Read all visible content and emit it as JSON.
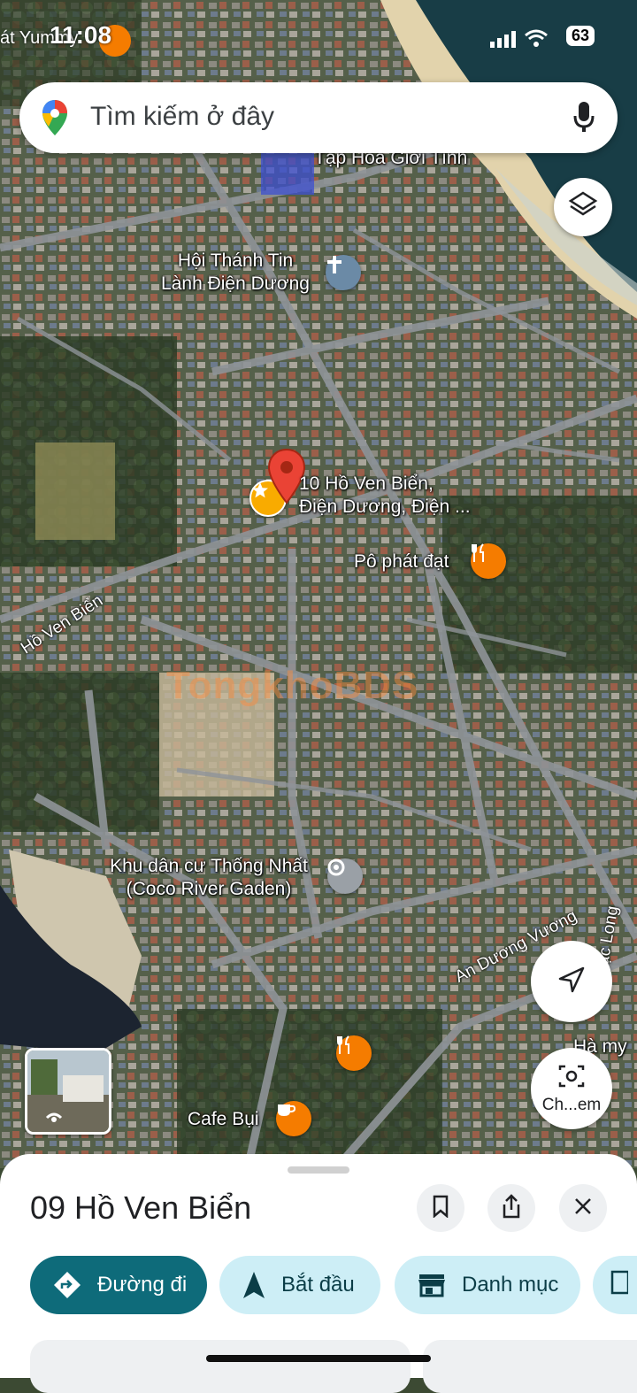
{
  "status": {
    "carrier": "át Yummy",
    "time": "11:08",
    "battery": "63"
  },
  "search": {
    "placeholder": "Tìm kiếm ở đây"
  },
  "map": {
    "labels": {
      "top_partial": "Tạp Hóa Giới Tính",
      "church_line1": "Hội Thánh Tin",
      "church_line2": "Lành Điện Dương",
      "pin_line1": "10 Hồ Ven Biển,",
      "pin_line2": "Điện Dương, Điện ...",
      "restaurant": "Pô phát đạt",
      "road_ho_ven_bien": "Hồ Ven Biển",
      "residential_line1": "Khu dân cư Thống Nhất",
      "residential_line2": "(Coco River Gaden)",
      "road_an_duong_vuong": "An Dương Vương",
      "road_lac_long": "Lạc Long",
      "ha_my": "Hà my",
      "cafe": "Cafe Bụi",
      "lens_label": "Ch...em"
    },
    "watermark": "TongkhoBDS"
  },
  "sheet": {
    "title": "09 Hồ Ven Biển",
    "chips": {
      "directions": "Đường đi",
      "start": "Bắt đầu",
      "category": "Danh mục"
    }
  },
  "icons": [
    "maps-logo-icon",
    "mic-icon",
    "layers-icon",
    "church-icon",
    "star-icon",
    "map-pin-icon",
    "restaurant-icon",
    "place-icon",
    "navigation-arrow-icon",
    "lens-icon",
    "cafe-icon",
    "bookmark-icon",
    "share-icon",
    "close-icon",
    "directions-icon",
    "start-arrow-icon",
    "store-icon"
  ],
  "colors": {
    "pin": "#ea4335",
    "restaurant": "#f57c00",
    "primary_chip": "#0e6b7a",
    "chip": "#cdeef6"
  }
}
